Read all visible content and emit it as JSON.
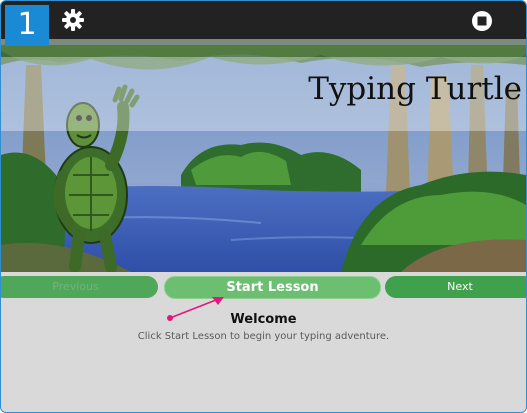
{
  "toolbar": {
    "lesson_number": "1",
    "settings_icon": "gear-icon",
    "stop_icon": "stop-icon"
  },
  "scene": {
    "title": "Typing Turtle"
  },
  "nav": {
    "previous_label": "Previous",
    "start_label": "Start Lesson",
    "next_label": "Next"
  },
  "message": {
    "title": "Welcome",
    "text": "Click Start Lesson to begin your typing adventure."
  },
  "colors": {
    "badge": "#1a8ad4",
    "toolbar": "#222222",
    "button_green": "#6cbf70",
    "arrow": "#e0197d"
  }
}
